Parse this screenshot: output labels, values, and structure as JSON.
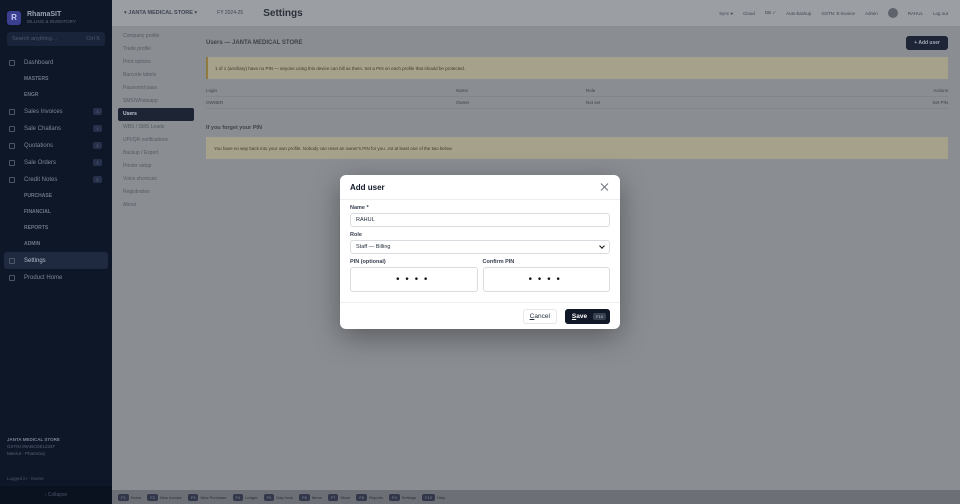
{
  "sidebar": {
    "brand_letter": "R",
    "brand_name": "RhamaSIT",
    "brand_sub": "BILLING & INVENTORY",
    "search_placeholder": "Search anything…",
    "search_kbd": "Ctrl K",
    "items": [
      {
        "label": "Dashboard",
        "type": "main"
      },
      {
        "label": "MASTERS",
        "type": "sub"
      },
      {
        "label": "ENGR",
        "type": "sub"
      },
      {
        "label": "Sales Invoices",
        "type": "main",
        "badge": "3"
      },
      {
        "label": "Sale Challans",
        "type": "main",
        "badge": "1"
      },
      {
        "label": "Quotations",
        "type": "main",
        "badge": "2"
      },
      {
        "label": "Sale Orders",
        "type": "main",
        "badge": "1"
      },
      {
        "label": "Credit Notes",
        "type": "main",
        "badge": "2"
      },
      {
        "label": "PURCHASE",
        "type": "sub"
      },
      {
        "label": "FINANCIAL",
        "type": "sub"
      },
      {
        "label": "REPORTS",
        "type": "sub"
      },
      {
        "label": "ADMIN",
        "type": "sub"
      },
      {
        "label": "Settings",
        "type": "main",
        "active": true
      },
      {
        "label": "Product Home",
        "type": "main"
      }
    ],
    "store_name": "JANTA MEDICAL STORE",
    "store_gstin": "GSTIN 09ABCDE1234F",
    "store_location": "Meerut · Pharmacy",
    "footer_user": "Logged in · Owner",
    "collapse_label": "‹ Collapse"
  },
  "topbar": {
    "store": "▾  JANTA MEDICAL STORE  ▾",
    "fy": "FY 2024-25",
    "title": "Settings",
    "status_items": [
      "Sync ●",
      "Cloud",
      "DB ✓",
      "Auto-backup",
      "GSTN: E-invoice",
      "Admin"
    ],
    "user": "RAHUL",
    "logout": "Log out"
  },
  "settings_nav": [
    "Company profile",
    "Trade profile",
    "Print options",
    "Barcode labels",
    "Password pass",
    "SMS/Whatsapp",
    "Users",
    "WBS / SMS Leads",
    "UPI/QR notifications",
    "Backup / Export",
    "Printer setup",
    "Voice shortcuts",
    "Registration",
    "About"
  ],
  "content": {
    "users_title": "Users — JANTA MEDICAL STORE",
    "add_user": "+ Add user",
    "note": "1 of 1 (ancillary) have no PIN — anyone using this device can bill as them. Set a PIN on each profile that should be protected.",
    "table_headers": [
      "Login",
      "Name",
      "Role",
      "Actions"
    ],
    "table_row": [
      "OWNER",
      "Owner",
      "Not set",
      "Set PIN"
    ],
    "pin_heading": "If you forget your PIN",
    "pin_note": "You have no way back into your own profile. Nobody can reset an owner's PIN for you. Jot at least one of the two below."
  },
  "bottombar": [
    {
      "key": "F1",
      "label": "Home"
    },
    {
      "key": "F2",
      "label": "New Invoice"
    },
    {
      "key": "F3",
      "label": "New Purchase"
    },
    {
      "key": "F4",
      "label": "Ledger"
    },
    {
      "key": "F5",
      "label": "Day book"
    },
    {
      "key": "F6",
      "label": "Items"
    },
    {
      "key": "F7",
      "label": "Stock"
    },
    {
      "key": "F8",
      "label": "Reports"
    },
    {
      "key": "F9",
      "label": "Settings"
    },
    {
      "key": "F10",
      "label": "Help"
    }
  ],
  "modal": {
    "title": "Add user",
    "name_label": "Name *",
    "name_value": "RAHUL",
    "role_label": "Role",
    "role_value": "Staff — Billing",
    "pin_label": "PIN (optional)",
    "pin_value": "••••",
    "confirm_label": "Confirm PIN",
    "confirm_value": "••••",
    "cancel_label": "ancel",
    "cancel_first": "C",
    "save_first": "S",
    "save_rest": "ave",
    "save_kbd": "F10"
  }
}
